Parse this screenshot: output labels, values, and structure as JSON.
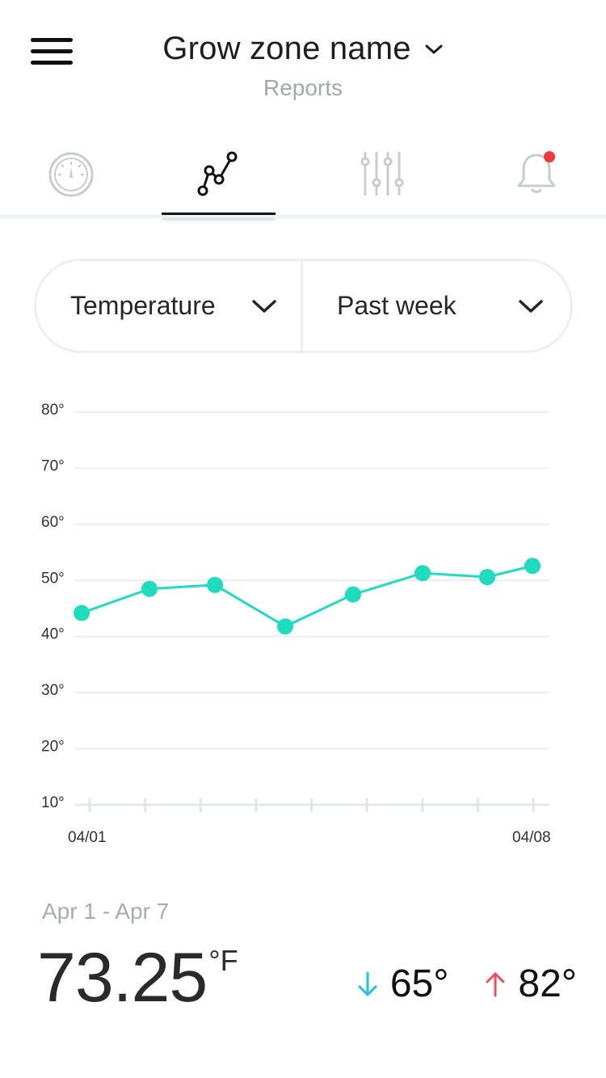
{
  "header": {
    "title": "Grow zone name",
    "subtitle": "Reports"
  },
  "tabs": [
    {
      "icon": "gauge-icon",
      "active": false
    },
    {
      "icon": "line-chart-icon",
      "active": true
    },
    {
      "icon": "sliders-icon",
      "active": false
    },
    {
      "icon": "bell-icon",
      "active": false,
      "badge": true
    }
  ],
  "selectors": {
    "metric": "Temperature",
    "period": "Past week"
  },
  "colors": {
    "series": "#1ddcbf",
    "badge": "#f03a3a",
    "down_arrow": "#1ec3e6",
    "up_arrow": "#ef4f5a"
  },
  "chart_data": {
    "type": "line",
    "y_ticks": [
      "80°",
      "70°",
      "60°",
      "50°",
      "40°",
      "30°",
      "20°",
      "10°"
    ],
    "ylim": [
      10,
      80
    ],
    "x_labels": [
      "04/01",
      "04/08"
    ],
    "series": [
      {
        "values": [
          44.2,
          48.5,
          49.2,
          41.8,
          47.5,
          51.3,
          50.6,
          52.6
        ]
      }
    ],
    "x_positions": [
      0.1,
      1.3,
      2.5,
      3.7,
      4.9,
      6.1,
      7.3,
      8.1
    ]
  },
  "summary": {
    "range": "Apr 1 - Apr 7",
    "average": "73.25",
    "unit": "°F",
    "min": "65°",
    "max": "82°"
  }
}
